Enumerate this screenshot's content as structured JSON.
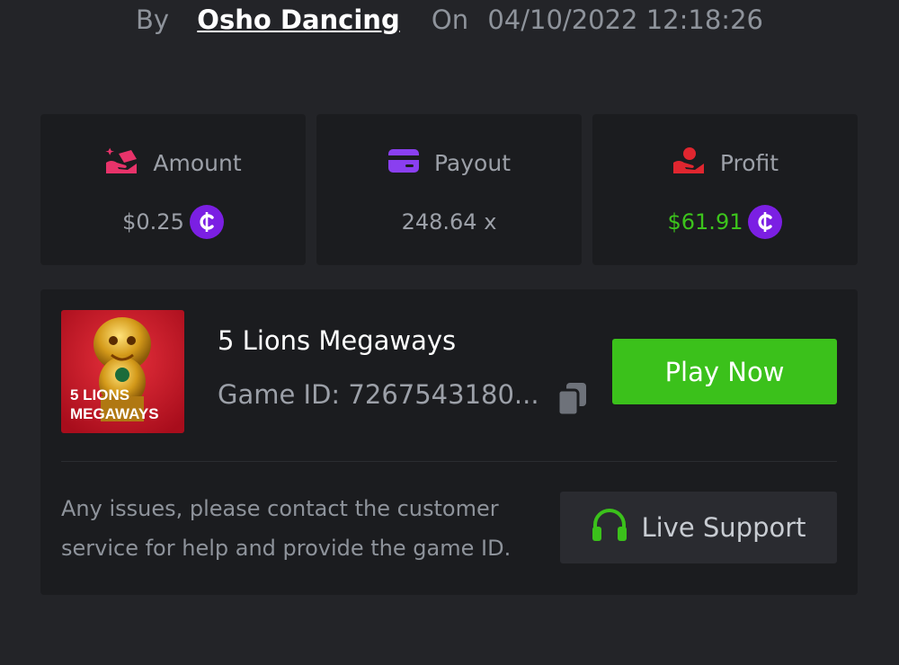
{
  "header": {
    "by_label": "By",
    "username": "Osho Dancing",
    "on_label": "On",
    "datetime": "04/10/2022 12:18:26"
  },
  "stats": {
    "amount": {
      "label": "Amount",
      "value": "$0.25",
      "icon": "amount-hand-icon",
      "icon_color": "#e8336a"
    },
    "payout": {
      "label": "Payout",
      "value": "248.64 x",
      "icon": "card-icon",
      "icon_color": "#8a3ff0"
    },
    "profit": {
      "label": "Profit",
      "value": "$61.91",
      "icon": "hand-coin-icon",
      "icon_color": "#e0262f",
      "value_color": "#3cc41c"
    },
    "coin_symbol": "₵",
    "coin_color": "#7b1fe3"
  },
  "game": {
    "title": "5 Lions Megaways",
    "id_text": "Game ID: 7267543180...",
    "thumbnail_text_line1": "5 LIONS",
    "thumbnail_text_line2": "MEGAWAYS",
    "play_button": "Play Now",
    "play_color": "#3bc11b"
  },
  "support": {
    "message": "Any issues, please contact the customer service for help and provide the game ID.",
    "button": "Live Support",
    "icon": "headset-icon",
    "icon_color": "#3bc11b"
  }
}
